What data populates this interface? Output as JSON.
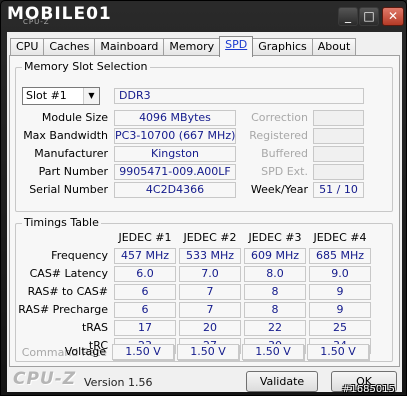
{
  "window": {
    "title": "MOBILE01",
    "title_small": "CPU-Z",
    "minimize": "_",
    "maximize": "□",
    "close": "✕"
  },
  "tabs": [
    {
      "label": "CPU"
    },
    {
      "label": "Caches"
    },
    {
      "label": "Mainboard"
    },
    {
      "label": "Memory"
    },
    {
      "label": "SPD",
      "active": true
    },
    {
      "label": "Graphics"
    },
    {
      "label": "About"
    }
  ],
  "memory_slot": {
    "group_title": "Memory Slot Selection",
    "slot_selected": "Slot #1",
    "type": "DDR3",
    "fields": {
      "module_size": {
        "label": "Module Size",
        "value": "4096 MBytes"
      },
      "max_bandwidth": {
        "label": "Max Bandwidth",
        "value": "PC3-10700 (667 MHz)"
      },
      "manufacturer": {
        "label": "Manufacturer",
        "value": "Kingston"
      },
      "part_number": {
        "label": "Part Number",
        "value": "9905471-009.A00LF"
      },
      "serial_number": {
        "label": "Serial Number",
        "value": "4C2D4366"
      }
    },
    "right_fields": {
      "correction": {
        "label": "Correction",
        "value": ""
      },
      "registered": {
        "label": "Registered",
        "value": ""
      },
      "buffered": {
        "label": "Buffered",
        "value": ""
      },
      "spd_ext": {
        "label": "SPD Ext.",
        "value": ""
      },
      "week_year": {
        "label": "Week/Year",
        "value": "51 / 10"
      }
    }
  },
  "timings": {
    "group_title": "Timings Table",
    "columns": [
      "JEDEC #1",
      "JEDEC #2",
      "JEDEC #3",
      "JEDEC #4"
    ],
    "rows": [
      {
        "label": "Frequency",
        "dim": false,
        "values": [
          "457 MHz",
          "533 MHz",
          "609 MHz",
          "685 MHz"
        ]
      },
      {
        "label": "CAS# Latency",
        "dim": false,
        "values": [
          "6.0",
          "7.0",
          "8.0",
          "9.0"
        ]
      },
      {
        "label": "RAS# to CAS#",
        "dim": false,
        "values": [
          "6",
          "7",
          "8",
          "9"
        ]
      },
      {
        "label": "RAS# Precharge",
        "dim": false,
        "values": [
          "6",
          "7",
          "8",
          "9"
        ]
      },
      {
        "label": "tRAS",
        "dim": false,
        "values": [
          "17",
          "20",
          "22",
          "25"
        ]
      },
      {
        "label": "tRC",
        "dim": false,
        "values": [
          "23",
          "27",
          "30",
          "34"
        ]
      },
      {
        "label": "Command Rate",
        "dim": true,
        "values": [
          "",
          "",
          "",
          ""
        ]
      },
      {
        "label": "Voltage",
        "dim": false,
        "values": [
          "1.50 V",
          "1.50 V",
          "1.50 V",
          "1.50 V"
        ]
      }
    ]
  },
  "footer": {
    "logo": "CPU-Z",
    "version": "Version 1.56",
    "validate": "Validate",
    "ok": "OK",
    "watermark": "#1685015"
  }
}
